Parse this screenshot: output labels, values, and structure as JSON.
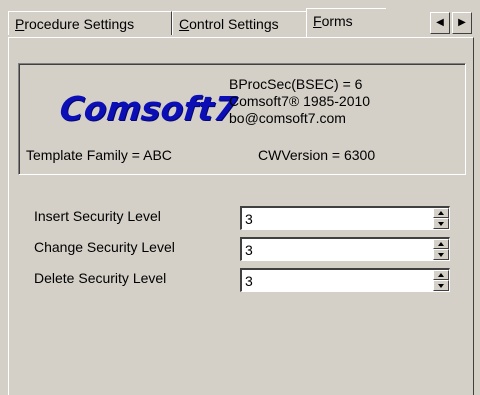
{
  "tabs": [
    {
      "label": "Procedure Settings",
      "access_key": "P",
      "rest": "rocedure Settings",
      "active": false
    },
    {
      "label": "Control Settings",
      "access_key": "C",
      "rest": "ontrol Settings",
      "active": false
    },
    {
      "label": "Forms",
      "access_key": "F",
      "rest": "orms",
      "active": true
    }
  ],
  "tab_clip_glyph": "{",
  "tab_scroll": {
    "left_glyph": "◀",
    "right_glyph": "▶"
  },
  "info": {
    "logo_text": "Comsoft7",
    "proc_sec": "BProcSec(BSEC) = 6",
    "copyright": "Comsoft7® 1985-2010",
    "email": "bo@comsoft7.com",
    "template_family": "Template Family = ABC",
    "cw_version": "CWVersion = 6300"
  },
  "security": [
    {
      "label": "Insert Security Level",
      "value": "3"
    },
    {
      "label": "Change Security Level",
      "value": "3"
    },
    {
      "label": "Delete Security Level",
      "value": "3"
    }
  ],
  "colors": {
    "logo": "#0b0fb5",
    "face": "#d4d0c8"
  }
}
